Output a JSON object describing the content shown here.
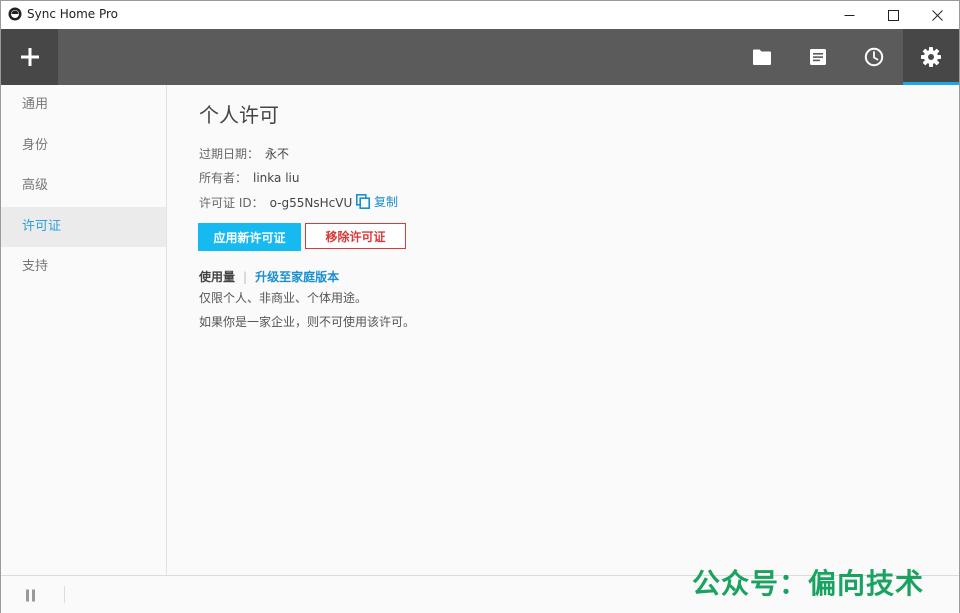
{
  "window": {
    "title": "Sync Home Pro"
  },
  "sidebar": {
    "items": [
      {
        "label": "通用"
      },
      {
        "label": "身份"
      },
      {
        "label": "高级"
      },
      {
        "label": "许可证",
        "active": true
      },
      {
        "label": "支持"
      }
    ]
  },
  "main": {
    "title": "个人许可",
    "expiry_label": "过期日期：",
    "expiry_value": "永不",
    "owner_label": "所有者：",
    "owner_value": "linka liu",
    "license_id_label": "许可证 ID：",
    "license_id_value": "o-g55NsHcVU",
    "copy_label": "复制",
    "apply_button": "应用新许可证",
    "remove_button": "移除许可证",
    "usage_label": "使用量",
    "upgrade_link": "升级至家庭版本",
    "desc_line1": "仅限个人、非商业、个体用途。",
    "desc_line2": "如果你是一家企业，则不可使用该许可。"
  },
  "watermark": {
    "text": "公众号：偏向技术"
  },
  "colors": {
    "accent": "#1ea7e8",
    "apply_bg": "#17b9f1",
    "remove": "#d83a3a",
    "toolbar_bg": "#5b5b5b",
    "watermark": "#1aa260"
  },
  "icons": [
    "app-logo-icon",
    "minimize-icon",
    "maximize-icon",
    "close-icon",
    "plus-icon",
    "folder-icon",
    "document-icon",
    "clock-icon",
    "gear-icon",
    "copy-icon",
    "pause-icon"
  ]
}
